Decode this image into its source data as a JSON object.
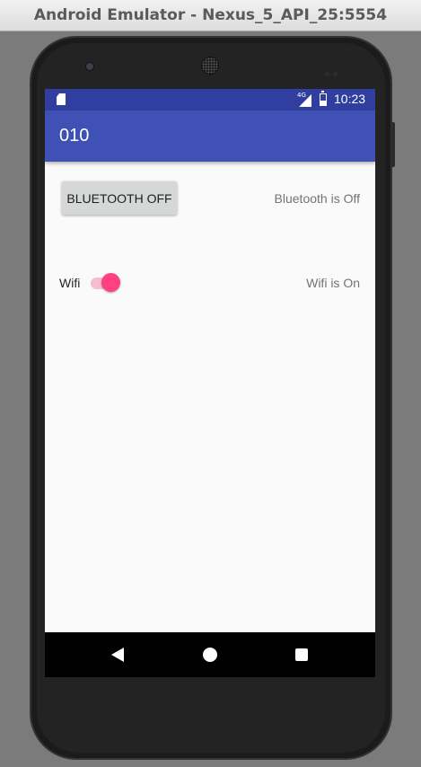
{
  "window": {
    "title": "Android Emulator - Nexus_5_API_25:5554"
  },
  "status_bar": {
    "network": "4G",
    "time": "10:23",
    "icons": [
      "sd-card-icon",
      "signal-icon",
      "battery-icon"
    ]
  },
  "app_bar": {
    "title": "010"
  },
  "bluetooth": {
    "button_label": "BLUETOOTH OFF",
    "status_text": "Bluetooth is Off"
  },
  "wifi": {
    "label": "Wifi",
    "switch_on": true,
    "status_text": "Wifi is On"
  },
  "nav_bar": {
    "icons": [
      "back-icon",
      "home-icon",
      "recents-icon"
    ]
  },
  "colors": {
    "status_bar": "#303f9f",
    "app_bar": "#3f51b5",
    "switch_accent": "#ff4081",
    "switch_track": "#f8bcd2",
    "button_bg": "#d6d7d7",
    "screen_bg": "#fafafa"
  }
}
